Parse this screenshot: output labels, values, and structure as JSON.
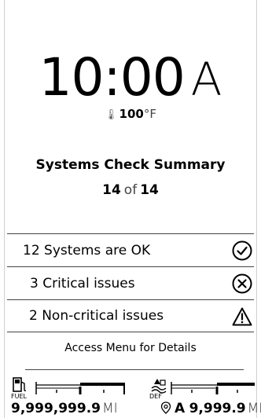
{
  "clock": {
    "time": "10:00",
    "ampm": "A"
  },
  "temperature": {
    "icon": "thermometer-icon",
    "value": "100",
    "unit": "°F"
  },
  "summary": {
    "title": "Systems Check Summary",
    "current": "14",
    "of": "of",
    "total": "14"
  },
  "rows": [
    {
      "label": "12 Systems are OK",
      "icon": "check-circle-icon"
    },
    {
      "label": "3 Critical issues",
      "icon": "x-circle-icon"
    },
    {
      "label": "2 Non-critical issues",
      "icon": "warning-triangle-icon"
    }
  ],
  "details_text": "Access Menu for Details",
  "fuel": {
    "caption": "FUEL",
    "icon": "fuel-pump-icon",
    "value": "9,999,999.9",
    "unit": "MI"
  },
  "def": {
    "caption": "DEF",
    "icon": "def-fluid-icon",
    "prefix": "A",
    "value": "9,999.9",
    "unit": "MI",
    "pin_icon": "location-pin-icon"
  },
  "colors": {
    "background": "#ffffff",
    "text": "#000000",
    "divider": "#444444"
  }
}
